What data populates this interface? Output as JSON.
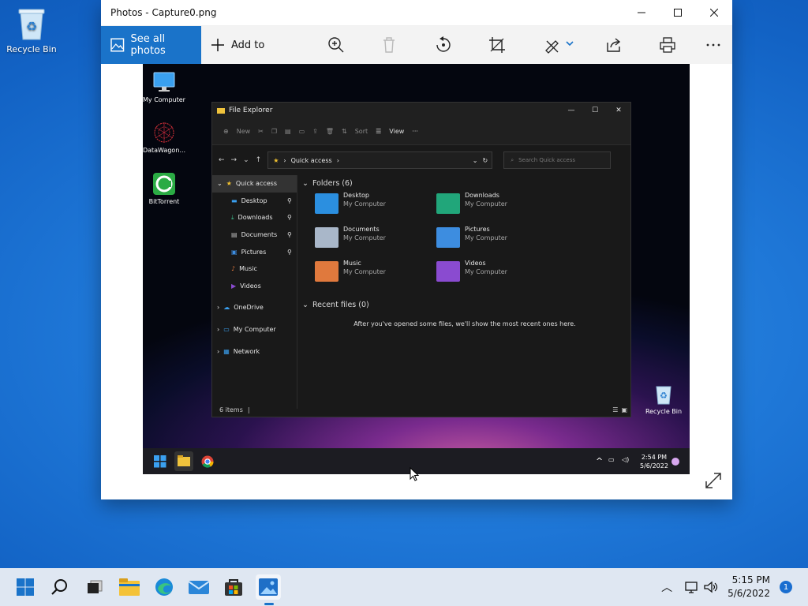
{
  "desktop": {
    "icons": [
      {
        "label": "Recycle Bin"
      }
    ]
  },
  "photos_window": {
    "title": "Photos - Capture0.png",
    "toolbar": {
      "see_all_label": "See all photos",
      "add_to_label": "Add to",
      "icons": [
        "zoom-icon",
        "delete-icon",
        "rotate-icon",
        "crop-icon",
        "edit-icon",
        "share-icon",
        "print-icon",
        "more-icon"
      ]
    }
  },
  "capture": {
    "desktop_icons": [
      {
        "label": "My Computer"
      },
      {
        "label": "DataWagon..."
      },
      {
        "label": "BitTorrent"
      },
      {
        "label": "Recycle Bin"
      }
    ],
    "file_explorer": {
      "title": "File Explorer",
      "command_bar": {
        "new": "New",
        "sort": "Sort",
        "view": "View",
        "more": "···"
      },
      "address": "Quick access",
      "search_placeholder": "Search Quick access",
      "nav": {
        "quick_access": "Quick access",
        "items": [
          "Desktop",
          "Downloads",
          "Documents",
          "Pictures",
          "Music",
          "Videos"
        ],
        "onedrive": "OneDrive",
        "my_computer": "My Computer",
        "network": "Network"
      },
      "folders_header": "Folders (6)",
      "folders": [
        {
          "name": "Desktop",
          "location": "My Computer",
          "color": "#2b8fe0"
        },
        {
          "name": "Downloads",
          "location": "My Computer",
          "color": "#21a67a"
        },
        {
          "name": "Documents",
          "location": "My Computer",
          "color": "#a9b7c9"
        },
        {
          "name": "Pictures",
          "location": "My Computer",
          "color": "#3d8de0"
        },
        {
          "name": "Music",
          "location": "My Computer",
          "color": "#e0793d"
        },
        {
          "name": "Videos",
          "location": "My Computer",
          "color": "#8a4bd0"
        }
      ],
      "recent_header": "Recent files (0)",
      "recent_empty": "After you've opened some files, we'll show the most recent ones here.",
      "status": "6 items"
    },
    "taskbar": {
      "time": "2:54 PM",
      "date": "5/6/2022"
    }
  },
  "taskbar": {
    "apps": [
      "start-icon",
      "search-icon",
      "task-view-icon",
      "file-explorer-icon",
      "edge-icon",
      "mail-icon",
      "store-icon",
      "photos-icon"
    ],
    "time": "5:15 PM",
    "date": "5/6/2022",
    "notification_count": "1"
  }
}
